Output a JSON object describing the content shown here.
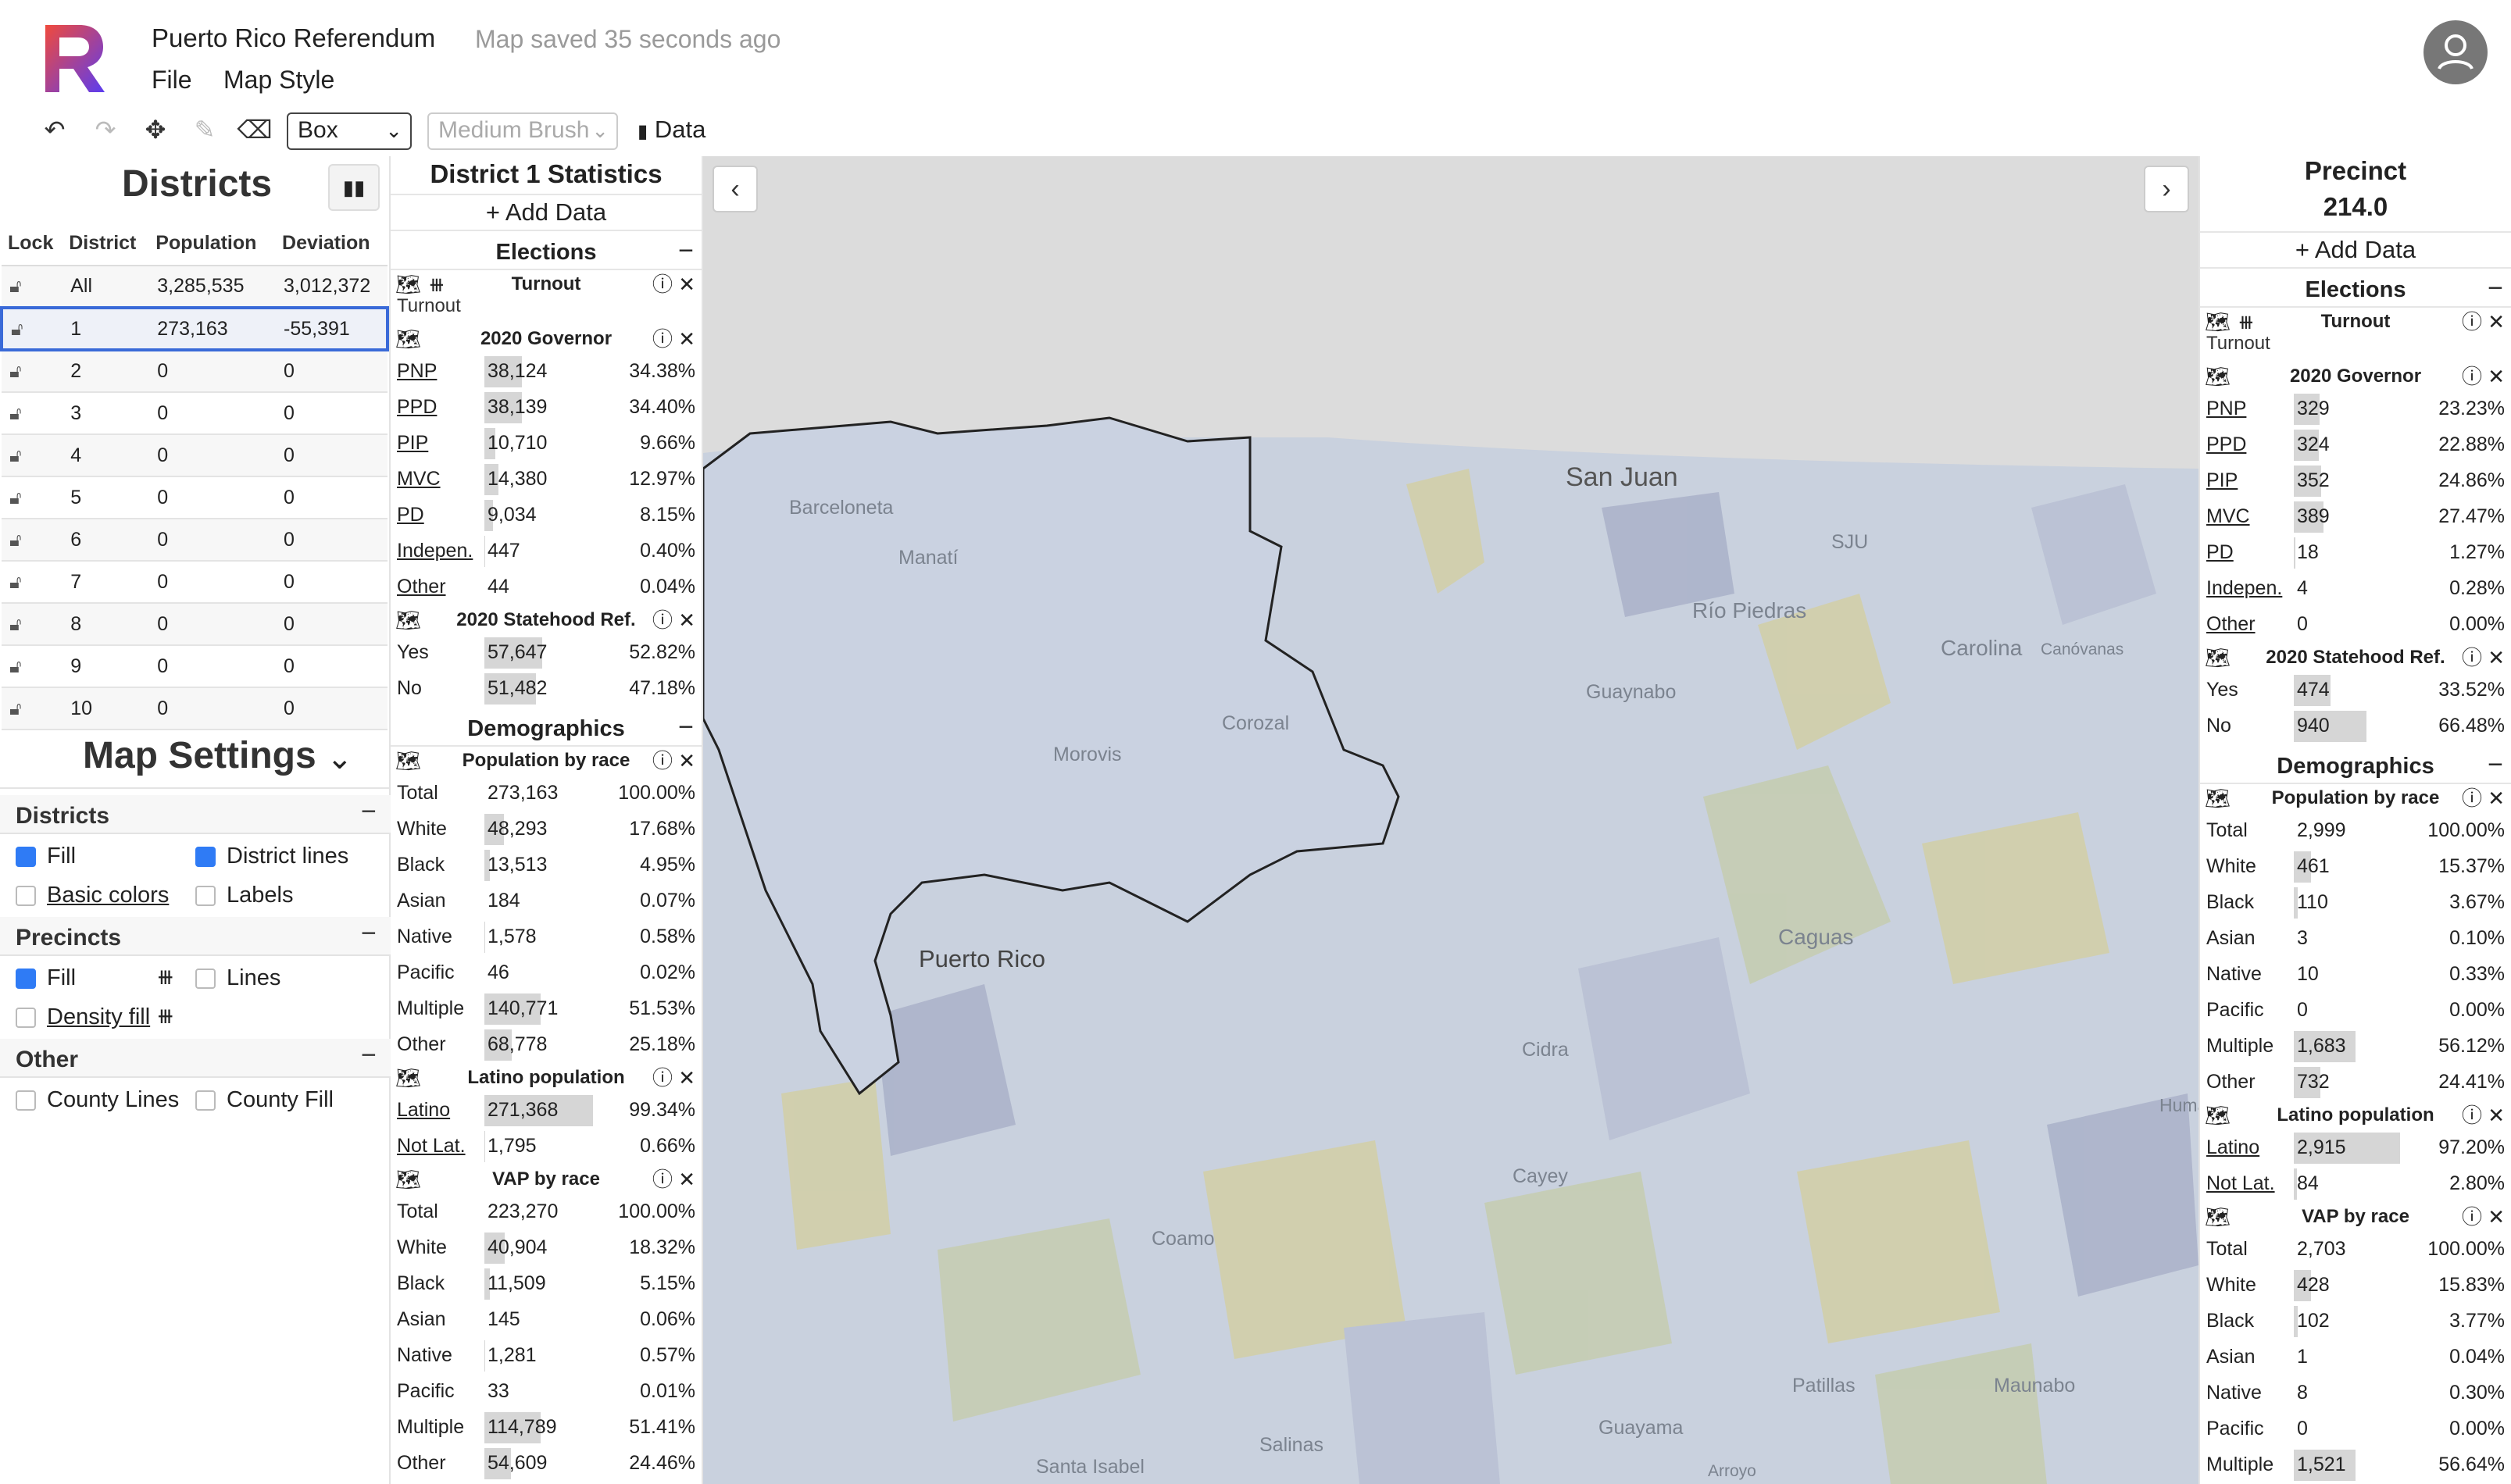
{
  "app": {
    "title": "Puerto Rico Referendum",
    "saved_status": "Map saved 35 seconds ago",
    "menu": [
      "File",
      "Map Style"
    ],
    "brand_color": "#e0392b"
  },
  "toolbar": {
    "tool_select": "Box",
    "brush_select": "Medium Brush",
    "data_label": "Data",
    "icons": [
      "undo-icon",
      "redo-icon",
      "move-icon",
      "edit-icon",
      "eraser-icon"
    ]
  },
  "districts": {
    "title": "Districts",
    "columns": [
      "Lock",
      "District",
      "Population",
      "Deviation"
    ],
    "rows": [
      {
        "district": "All",
        "population": "3,285,535",
        "deviation": "3,012,372"
      },
      {
        "district": "1",
        "population": "273,163",
        "deviation": "-55,391"
      },
      {
        "district": "2",
        "population": "0",
        "deviation": "0"
      },
      {
        "district": "3",
        "population": "0",
        "deviation": "0"
      },
      {
        "district": "4",
        "population": "0",
        "deviation": "0"
      },
      {
        "district": "5",
        "population": "0",
        "deviation": "0"
      },
      {
        "district": "6",
        "population": "0",
        "deviation": "0"
      },
      {
        "district": "7",
        "population": "0",
        "deviation": "0"
      },
      {
        "district": "8",
        "population": "0",
        "deviation": "0"
      },
      {
        "district": "9",
        "population": "0",
        "deviation": "0"
      },
      {
        "district": "10",
        "population": "0",
        "deviation": "0"
      }
    ],
    "selected_district": "1"
  },
  "map_settings": {
    "title": "Map Settings",
    "sections": {
      "districts": {
        "title": "Districts",
        "fill": "Fill",
        "district_lines": "District lines",
        "basic_colors": "Basic colors",
        "labels": "Labels"
      },
      "precincts": {
        "title": "Precincts",
        "fill": "Fill",
        "lines": "Lines",
        "density_fill": "Density fill"
      },
      "other": {
        "title": "Other",
        "county_lines": "County Lines",
        "county_fill": "County Fill"
      }
    }
  },
  "district_stats": {
    "title": "District 1 Statistics",
    "add_data": "+ Add Data",
    "elections_title": "Elections",
    "turnout": "Turnout",
    "turnout_note": "Turnout",
    "gov_title": "2020 Governor",
    "gov": [
      {
        "label": "PNP",
        "value": "38,124",
        "pct": "34.38%",
        "share": 0.3438
      },
      {
        "label": "PPD",
        "value": "38,139",
        "pct": "34.40%",
        "share": 0.344
      },
      {
        "label": "PIP",
        "value": "10,710",
        "pct": "9.66%",
        "share": 0.0966
      },
      {
        "label": "MVC",
        "value": "14,380",
        "pct": "12.97%",
        "share": 0.1297
      },
      {
        "label": "PD",
        "value": "9,034",
        "pct": "8.15%",
        "share": 0.0815
      },
      {
        "label": "Indepen.",
        "value": "447",
        "pct": "0.40%",
        "share": 0.004
      },
      {
        "label": "Other",
        "value": "44",
        "pct": "0.04%",
        "share": 0.0004
      }
    ],
    "ref_title": "2020 Statehood Ref.",
    "ref": [
      {
        "label": "Yes",
        "value": "57,647",
        "pct": "52.82%",
        "share": 0.5282
      },
      {
        "label": "No",
        "value": "51,482",
        "pct": "47.18%",
        "share": 0.4718
      }
    ],
    "demo_title": "Demographics",
    "race_title": "Population by race",
    "race": [
      {
        "label": "Total",
        "value": "273,163",
        "pct": "100.00%",
        "share": 0
      },
      {
        "label": "White",
        "value": "48,293",
        "pct": "17.68%",
        "share": 0.1768
      },
      {
        "label": "Black",
        "value": "13,513",
        "pct": "4.95%",
        "share": 0.0495
      },
      {
        "label": "Asian",
        "value": "184",
        "pct": "0.07%",
        "share": 0.0007
      },
      {
        "label": "Native",
        "value": "1,578",
        "pct": "0.58%",
        "share": 0.0058
      },
      {
        "label": "Pacific",
        "value": "46",
        "pct": "0.02%",
        "share": 0.0002
      },
      {
        "label": "Multiple",
        "value": "140,771",
        "pct": "51.53%",
        "share": 0.5153
      },
      {
        "label": "Other",
        "value": "68,778",
        "pct": "25.18%",
        "share": 0.2518
      }
    ],
    "latino_title": "Latino population",
    "latino": [
      {
        "label": "Latino",
        "value": "271,368",
        "pct": "99.34%",
        "share": 0.9934
      },
      {
        "label": "Not Lat.",
        "value": "1,795",
        "pct": "0.66%",
        "share": 0.0066
      }
    ],
    "vap_title": "VAP by race",
    "vap": [
      {
        "label": "Total",
        "value": "223,270",
        "pct": "100.00%",
        "share": 0
      },
      {
        "label": "White",
        "value": "40,904",
        "pct": "18.32%",
        "share": 0.1832
      },
      {
        "label": "Black",
        "value": "11,509",
        "pct": "5.15%",
        "share": 0.0515
      },
      {
        "label": "Asian",
        "value": "145",
        "pct": "0.06%",
        "share": 0.0006
      },
      {
        "label": "Native",
        "value": "1,281",
        "pct": "0.57%",
        "share": 0.0057
      },
      {
        "label": "Pacific",
        "value": "33",
        "pct": "0.01%",
        "share": 0.0001
      },
      {
        "label": "Multiple",
        "value": "114,789",
        "pct": "51.41%",
        "share": 0.5141
      },
      {
        "label": "Other",
        "value": "54,609",
        "pct": "24.46%",
        "share": 0.2446
      }
    ]
  },
  "precinct_stats": {
    "title": "Precinct",
    "id": "214.0",
    "add_data": "+ Add Data",
    "elections_title": "Elections",
    "turnout": "Turnout",
    "turnout_note": "Turnout",
    "gov_title": "2020 Governor",
    "gov": [
      {
        "label": "PNP",
        "value": "329",
        "pct": "23.23%",
        "share": 0.2323
      },
      {
        "label": "PPD",
        "value": "324",
        "pct": "22.88%",
        "share": 0.2288
      },
      {
        "label": "PIP",
        "value": "352",
        "pct": "24.86%",
        "share": 0.2486
      },
      {
        "label": "MVC",
        "value": "389",
        "pct": "27.47%",
        "share": 0.2747
      },
      {
        "label": "PD",
        "value": "18",
        "pct": "1.27%",
        "share": 0.0127
      },
      {
        "label": "Indepen.",
        "value": "4",
        "pct": "0.28%",
        "share": 0.0028
      },
      {
        "label": "Other",
        "value": "0",
        "pct": "0.00%",
        "share": 0
      }
    ],
    "ref_title": "2020 Statehood Ref.",
    "ref": [
      {
        "label": "Yes",
        "value": "474",
        "pct": "33.52%",
        "share": 0.3352
      },
      {
        "label": "No",
        "value": "940",
        "pct": "66.48%",
        "share": 0.6648
      }
    ],
    "demo_title": "Demographics",
    "race_title": "Population by race",
    "race": [
      {
        "label": "Total",
        "value": "2,999",
        "pct": "100.00%",
        "share": 0
      },
      {
        "label": "White",
        "value": "461",
        "pct": "15.37%",
        "share": 0.1537
      },
      {
        "label": "Black",
        "value": "110",
        "pct": "3.67%",
        "share": 0.0367
      },
      {
        "label": "Asian",
        "value": "3",
        "pct": "0.10%",
        "share": 0.001
      },
      {
        "label": "Native",
        "value": "10",
        "pct": "0.33%",
        "share": 0.0033
      },
      {
        "label": "Pacific",
        "value": "0",
        "pct": "0.00%",
        "share": 0
      },
      {
        "label": "Multiple",
        "value": "1,683",
        "pct": "56.12%",
        "share": 0.5612
      },
      {
        "label": "Other",
        "value": "732",
        "pct": "24.41%",
        "share": 0.2441
      }
    ],
    "latino_title": "Latino population",
    "latino": [
      {
        "label": "Latino",
        "value": "2,915",
        "pct": "97.20%",
        "share": 0.972
      },
      {
        "label": "Not Lat.",
        "value": "84",
        "pct": "2.80%",
        "share": 0.028
      }
    ],
    "vap_title": "VAP by race",
    "vap": [
      {
        "label": "Total",
        "value": "2,703",
        "pct": "100.00%",
        "share": 0
      },
      {
        "label": "White",
        "value": "428",
        "pct": "15.83%",
        "share": 0.1583
      },
      {
        "label": "Black",
        "value": "102",
        "pct": "3.77%",
        "share": 0.0377
      },
      {
        "label": "Asian",
        "value": "1",
        "pct": "0.04%",
        "share": 0.0004
      },
      {
        "label": "Native",
        "value": "8",
        "pct": "0.30%",
        "share": 0.003
      },
      {
        "label": "Pacific",
        "value": "0",
        "pct": "0.00%",
        "share": 0
      },
      {
        "label": "Multiple",
        "value": "1,521",
        "pct": "56.64%",
        "share": 0.5664
      }
    ]
  },
  "map": {
    "labels": [
      "San Juan",
      "Barceloneta",
      "Manatí",
      "Morovis",
      "Corozal",
      "Puerto Rico",
      "Río Piedras",
      "SJU",
      "Guaynabo",
      "Carolina",
      "Canóvanas",
      "Caguas",
      "Cidra",
      "Cayey",
      "Coamo",
      "Salinas",
      "Patillas",
      "Maunabo",
      "Guayama",
      "Santa Isabel",
      "Arroyo",
      "Humac"
    ],
    "district_color": "#cbd3e2",
    "precinct_colors": [
      "#c5cdb0",
      "#d2cfa6",
      "#b9c0d4",
      "#aab2c9"
    ]
  }
}
